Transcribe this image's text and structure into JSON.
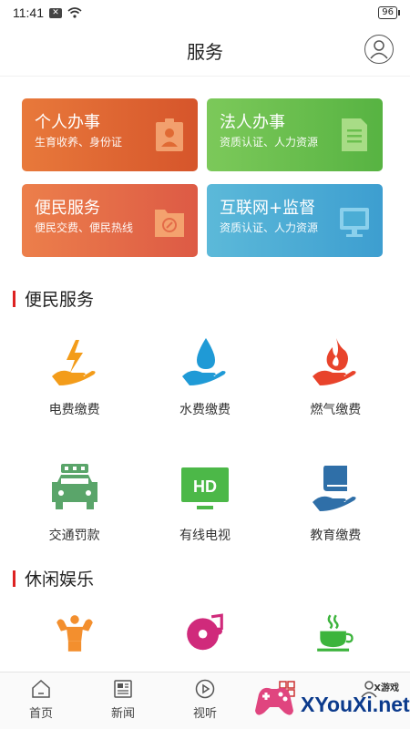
{
  "status": {
    "time": "11:41",
    "battery": "96"
  },
  "header": {
    "title": "服务",
    "user_icon": "user-icon"
  },
  "cards": [
    {
      "title": "个人办事",
      "subtitle": "生育收养、身份证",
      "icon": "id-card-icon"
    },
    {
      "title": "法人办事",
      "subtitle": "资质认证、人力资源",
      "icon": "document-icon"
    },
    {
      "title": "便民服务",
      "subtitle": "便民交费、便民热线",
      "icon": "folder-icon"
    },
    {
      "title": "互联网+监督",
      "subtitle": "资质认证、人力资源",
      "icon": "monitor-icon"
    }
  ],
  "section1": {
    "title": "便民服务"
  },
  "services": [
    {
      "label": "电费缴费",
      "icon": "electricity-icon"
    },
    {
      "label": "水费缴费",
      "icon": "water-icon"
    },
    {
      "label": "燃气缴费",
      "icon": "gas-icon"
    },
    {
      "label": "交通罚款",
      "icon": "car-icon"
    },
    {
      "label": "有线电视",
      "icon": "tv-icon"
    },
    {
      "label": "教育缴费",
      "icon": "book-icon"
    }
  ],
  "section2": {
    "title": "休闲娱乐"
  },
  "leisure": [
    {
      "label": "",
      "icon": "fitness-icon"
    },
    {
      "label": "",
      "icon": "music-icon"
    },
    {
      "label": "",
      "icon": "tea-icon"
    }
  ],
  "tabs": [
    {
      "label": "首页",
      "icon": "home-icon"
    },
    {
      "label": "新闻",
      "icon": "news-icon"
    },
    {
      "label": "视听",
      "icon": "play-icon"
    },
    {
      "label": "",
      "icon": "service-icon"
    },
    {
      "label": "",
      "icon": "mine-icon"
    }
  ],
  "watermark": {
    "text": "XYouXi.net",
    "small": "X游戏"
  },
  "colors": {
    "accent": "#d22222",
    "card1": "#e06a34",
    "card2": "#6bbf4e",
    "card3": "#e46b48",
    "card4": "#4badd5"
  }
}
